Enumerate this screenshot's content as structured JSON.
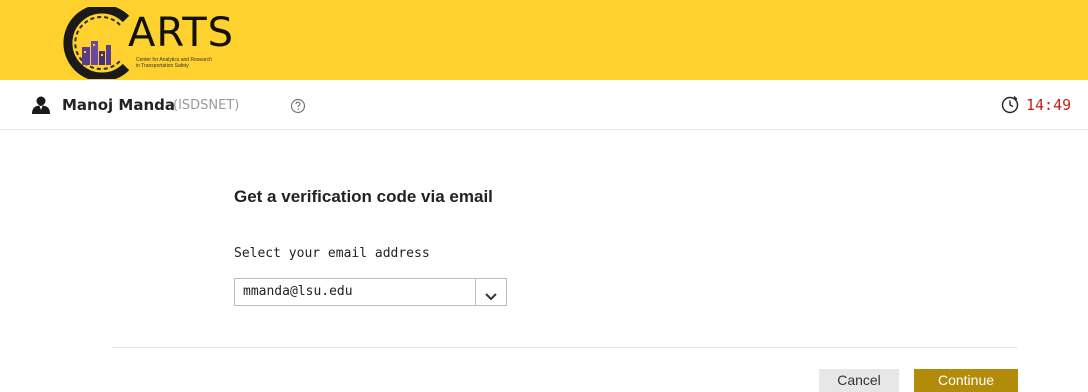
{
  "brand": {
    "logo_word": "ARTS",
    "logo_tagline": "Center for Analytics and Research\nin Transportation Safety",
    "banner_color": "#fed12e"
  },
  "user_bar": {
    "user_icon": "user-icon",
    "name": "Manoj Manda",
    "domain": "(ISDSNET)",
    "help_icon": "help-circle-icon",
    "timer_icon": "timer-icon",
    "timer": "14:49",
    "timer_color": "#d11b1b"
  },
  "form": {
    "title": "Get a verification code via email",
    "email_label": "Select your email address",
    "email_selected": "mmanda@lsu.edu",
    "dropdown_icon": "chevron-down-icon"
  },
  "actions": {
    "cancel_label": "Cancel",
    "continue_label": "Continue",
    "continue_color": "#b38b0b"
  }
}
